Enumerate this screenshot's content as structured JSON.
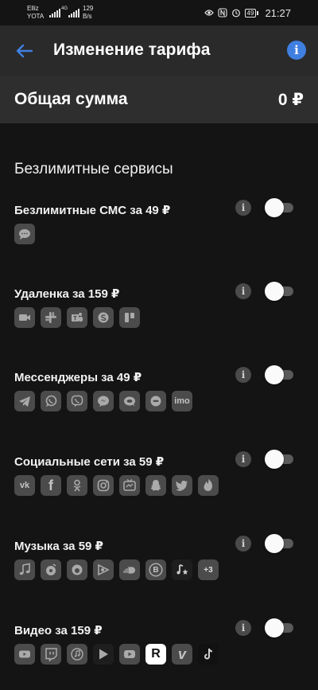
{
  "status_bar": {
    "operator_line1": "Elliz",
    "operator_line2": "YOTA",
    "network": "4G",
    "speed_value": "129",
    "speed_unit": "B/s",
    "battery": "49",
    "time": "21:27"
  },
  "app_bar": {
    "title": "Изменение тарифа",
    "info_symbol": "i"
  },
  "summary": {
    "label": "Общая сумма",
    "value": "0 ₽"
  },
  "section_title": "Безлимитные сервисы",
  "colors": {
    "background": "#141414",
    "app_bar": "#2a2a2a",
    "accent_blue": "#3f7fe0",
    "toggle_off_track": "#5a5a5a"
  },
  "services": [
    {
      "name": "Безлимитные СМС за 49 ₽",
      "enabled": false,
      "info": "i",
      "apps": [
        {
          "name": "sms-icon",
          "label": ""
        }
      ]
    },
    {
      "name": "Удаленка за 159 ₽",
      "enabled": false,
      "info": "i",
      "apps": [
        {
          "name": "video-camera-icon",
          "label": ""
        },
        {
          "name": "slack-icon",
          "label": ""
        },
        {
          "name": "teams-icon",
          "label": ""
        },
        {
          "name": "skype-icon",
          "label": ""
        },
        {
          "name": "trello-icon",
          "label": ""
        }
      ]
    },
    {
      "name": "Мессенджеры за 49 ₽",
      "enabled": false,
      "info": "i",
      "apps": [
        {
          "name": "telegram-icon",
          "label": ""
        },
        {
          "name": "whatsapp-icon",
          "label": ""
        },
        {
          "name": "viber-icon",
          "label": ""
        },
        {
          "name": "messenger-icon",
          "label": ""
        },
        {
          "name": "chat-bubble-icon",
          "label": ""
        },
        {
          "name": "messenger-alt-icon",
          "label": ""
        },
        {
          "name": "imo-icon",
          "label": "imo"
        }
      ]
    },
    {
      "name": "Социальные сети за 59 ₽",
      "enabled": false,
      "info": "i",
      "apps": [
        {
          "name": "vk-icon",
          "label": "vk"
        },
        {
          "name": "facebook-icon",
          "label": "f"
        },
        {
          "name": "odnoklassniki-icon",
          "label": ""
        },
        {
          "name": "instagram-icon",
          "label": ""
        },
        {
          "name": "tv-icon",
          "label": ""
        },
        {
          "name": "snapchat-icon",
          "label": ""
        },
        {
          "name": "twitter-icon",
          "label": ""
        },
        {
          "name": "tinder-icon",
          "label": ""
        }
      ]
    },
    {
      "name": "Музыка за 59 ₽",
      "enabled": false,
      "info": "i",
      "apps": [
        {
          "name": "music-note-icon",
          "label": ""
        },
        {
          "name": "music-player-icon",
          "label": ""
        },
        {
          "name": "headphones-icon",
          "label": ""
        },
        {
          "name": "play-music-icon",
          "label": ""
        },
        {
          "name": "soundcloud-icon",
          "label": ""
        },
        {
          "name": "boom-icon",
          "label": "B"
        },
        {
          "name": "music-star-icon",
          "label": ""
        },
        {
          "name": "more-apps-icon",
          "label": "+3"
        }
      ]
    },
    {
      "name": "Видео за 159 ₽",
      "enabled": false,
      "info": "i",
      "apps": [
        {
          "name": "youtube-icon",
          "label": ""
        },
        {
          "name": "twitch-icon",
          "label": ""
        },
        {
          "name": "itunes-icon",
          "label": ""
        },
        {
          "name": "play-store-icon",
          "label": ""
        },
        {
          "name": "video-play-icon",
          "label": ""
        },
        {
          "name": "rutube-icon",
          "label": "R"
        },
        {
          "name": "vimeo-icon",
          "label": "v"
        },
        {
          "name": "tiktok-icon",
          "label": ""
        }
      ]
    }
  ]
}
